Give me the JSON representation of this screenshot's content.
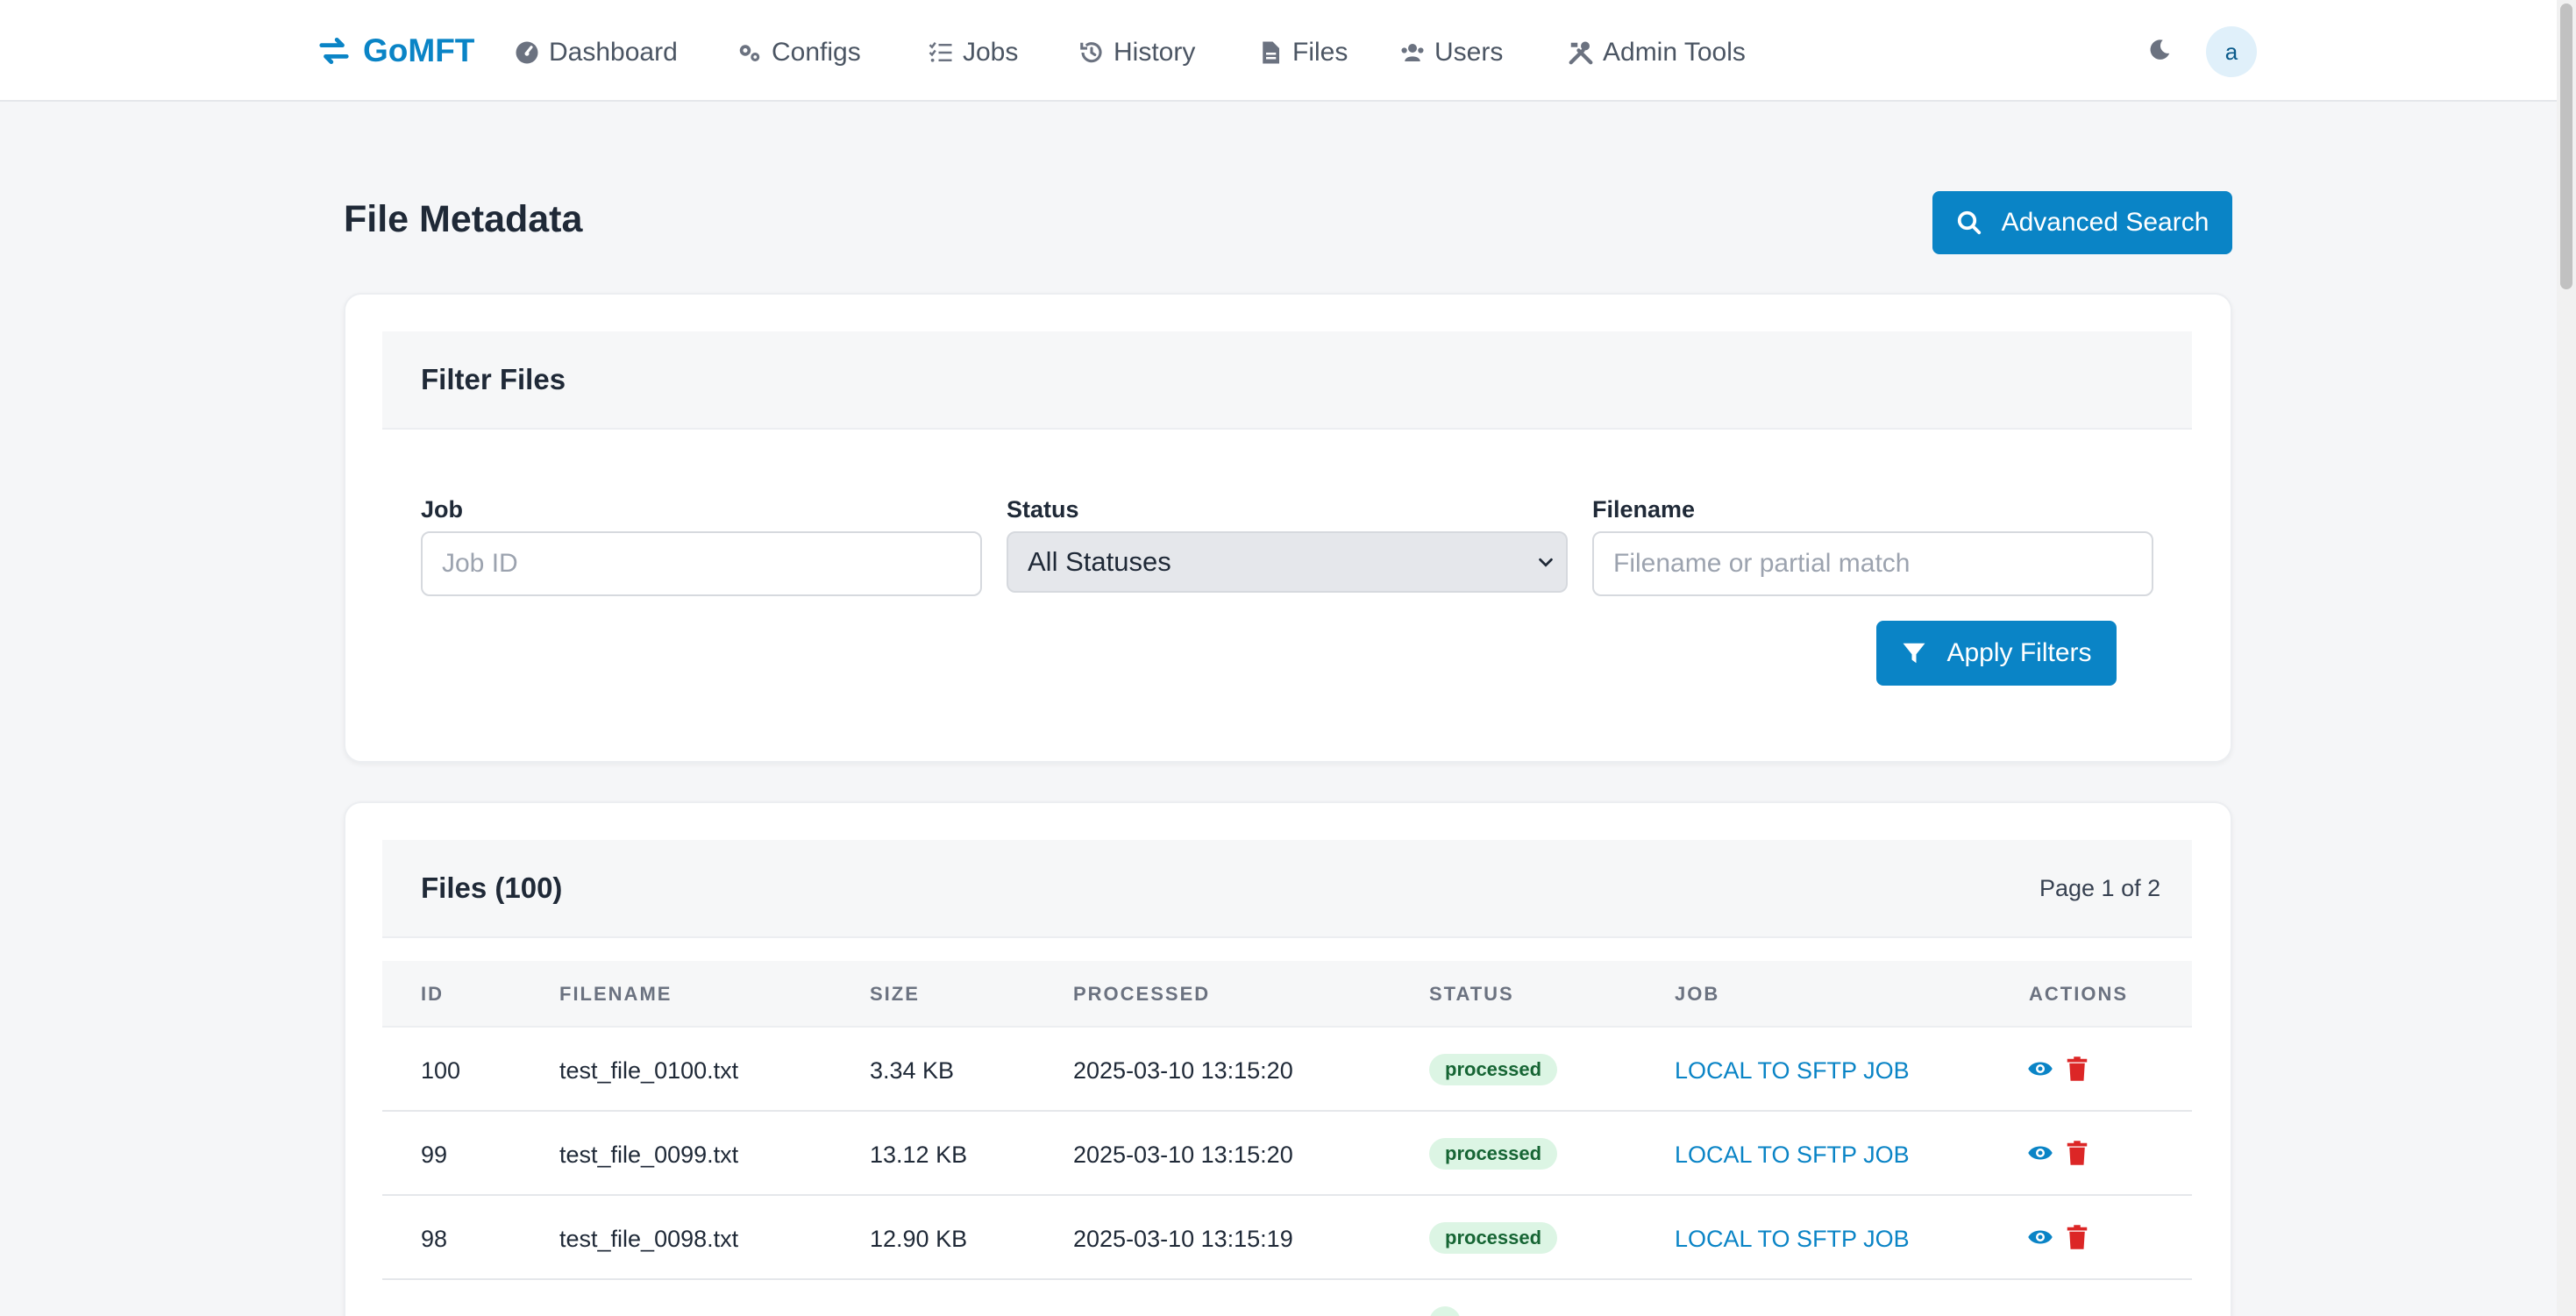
{
  "nav": {
    "brand": "GoMFT",
    "items": [
      {
        "label": "Dashboard",
        "icon": "dashboard-icon"
      },
      {
        "label": "Configs",
        "icon": "cogs-icon"
      },
      {
        "label": "Jobs",
        "icon": "list-check-icon"
      },
      {
        "label": "History",
        "icon": "history-icon"
      },
      {
        "label": "Files",
        "icon": "file-icon"
      },
      {
        "label": "Users",
        "icon": "users-icon"
      },
      {
        "label": "Admin Tools",
        "icon": "tools-icon"
      }
    ],
    "avatar_initial": "a"
  },
  "page": {
    "title": "File Metadata",
    "advanced_search_label": "Advanced Search"
  },
  "filter": {
    "title": "Filter Files",
    "job_label": "Job",
    "job_placeholder": "Job ID",
    "status_label": "Status",
    "status_selected": "All Statuses",
    "filename_label": "Filename",
    "filename_placeholder": "Filename or partial match",
    "apply_label": "Apply Filters"
  },
  "files": {
    "title": "Files (100)",
    "page_info": "Page 1 of 2",
    "columns": [
      "ID",
      "FILENAME",
      "SIZE",
      "PROCESSED",
      "STATUS",
      "JOB",
      "ACTIONS"
    ],
    "rows": [
      {
        "id": "100",
        "filename": "test_file_0100.txt",
        "size": "3.34 KB",
        "processed": "2025-03-10 13:15:20",
        "status": "processed",
        "job": "LOCAL TO SFTP JOB"
      },
      {
        "id": "99",
        "filename": "test_file_0099.txt",
        "size": "13.12 KB",
        "processed": "2025-03-10 13:15:20",
        "status": "processed",
        "job": "LOCAL TO SFTP JOB"
      },
      {
        "id": "98",
        "filename": "test_file_0098.txt",
        "size": "12.90 KB",
        "processed": "2025-03-10 13:15:19",
        "status": "processed",
        "job": "LOCAL TO SFTP JOB"
      }
    ]
  },
  "colors": {
    "accent": "#0a84c6",
    "danger": "#dc2626",
    "success_bg": "#dcf5e4",
    "success_text": "#166534"
  }
}
